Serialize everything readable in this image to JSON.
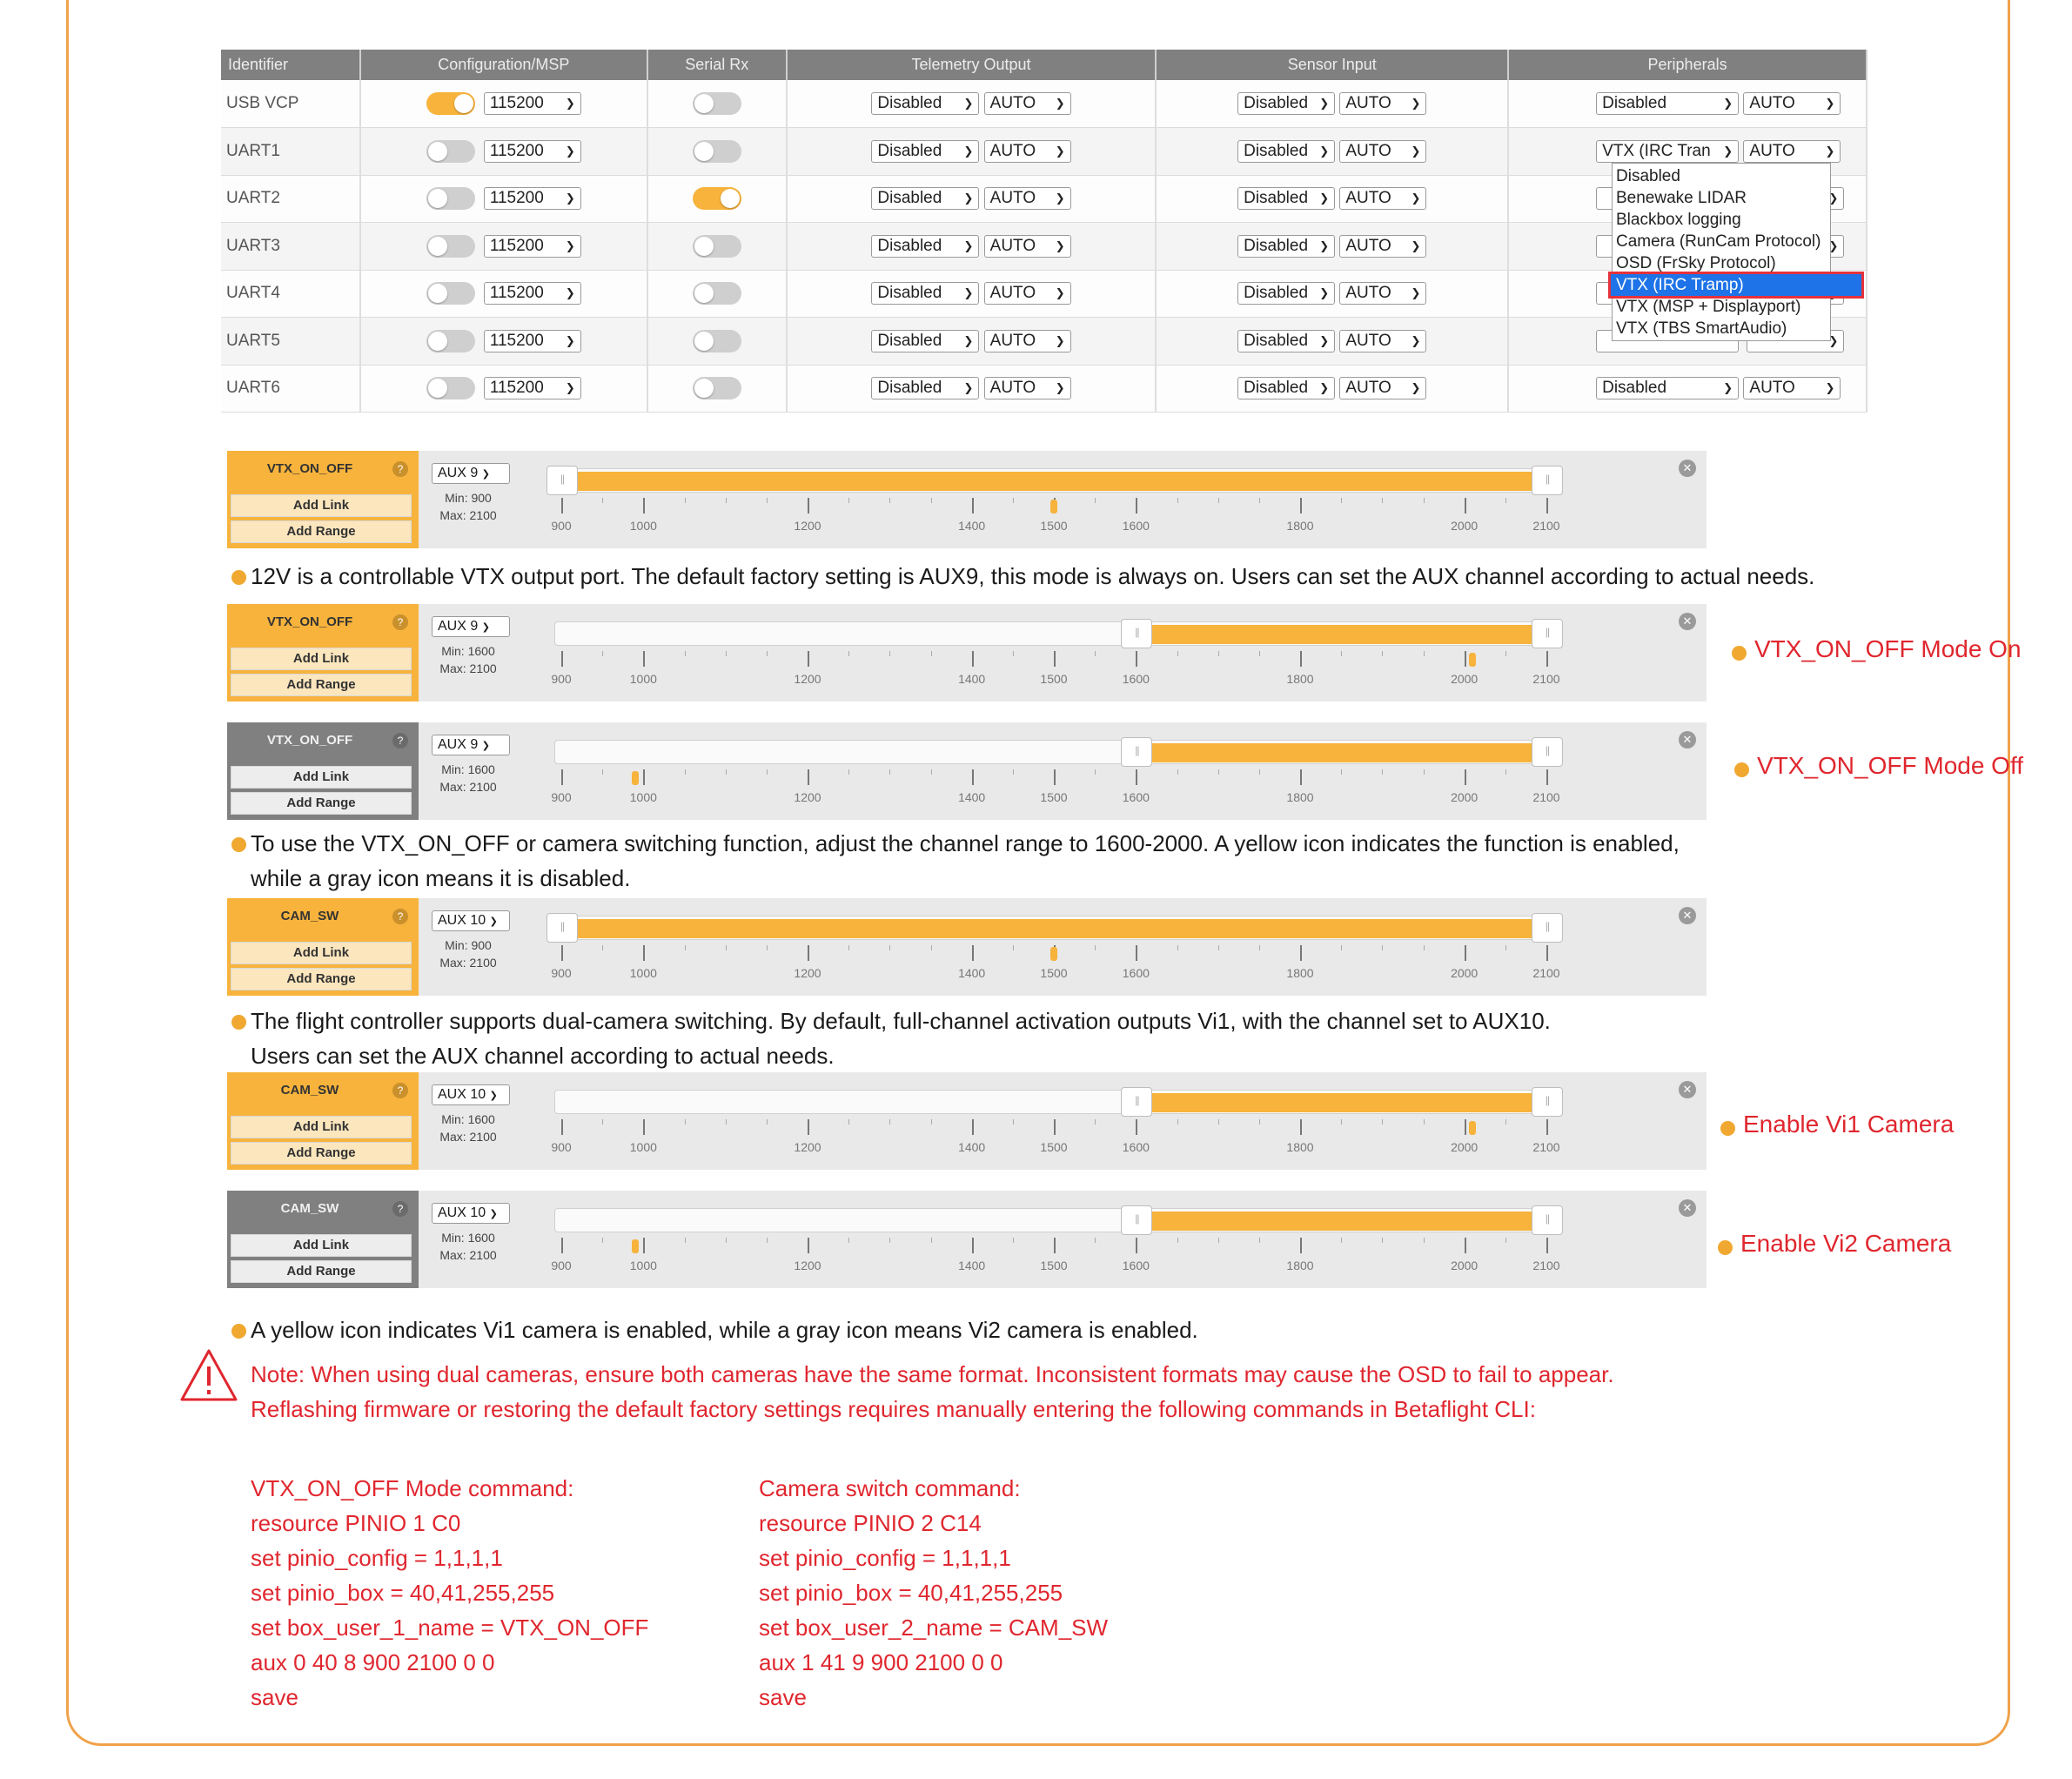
{
  "ports_table": {
    "headers": [
      "Identifier",
      "Configuration/MSP",
      "Serial Rx",
      "Telemetry Output",
      "Sensor Input",
      "Peripherals"
    ],
    "rows": [
      {
        "id": "USB VCP",
        "msp_on": true,
        "baud": "115200",
        "rx_on": false,
        "tel": "Disabled",
        "tel_auto": "AUTO",
        "sen": "Disabled",
        "sen_auto": "AUTO",
        "per": "Disabled",
        "per_auto": "AUTO"
      },
      {
        "id": "UART1",
        "msp_on": false,
        "baud": "115200",
        "rx_on": false,
        "tel": "Disabled",
        "tel_auto": "AUTO",
        "sen": "Disabled",
        "sen_auto": "AUTO",
        "per": "VTX (IRC Tran",
        "per_auto": "AUTO"
      },
      {
        "id": "UART2",
        "msp_on": false,
        "baud": "115200",
        "rx_on": true,
        "tel": "Disabled",
        "tel_auto": "AUTO",
        "sen": "Disabled",
        "sen_auto": "AUTO",
        "per": "",
        "per_auto": ""
      },
      {
        "id": "UART3",
        "msp_on": false,
        "baud": "115200",
        "rx_on": false,
        "tel": "Disabled",
        "tel_auto": "AUTO",
        "sen": "Disabled",
        "sen_auto": "AUTO",
        "per": "",
        "per_auto": ""
      },
      {
        "id": "UART4",
        "msp_on": false,
        "baud": "115200",
        "rx_on": false,
        "tel": "Disabled",
        "tel_auto": "AUTO",
        "sen": "Disabled",
        "sen_auto": "AUTO",
        "per": "",
        "per_auto": ""
      },
      {
        "id": "UART5",
        "msp_on": false,
        "baud": "115200",
        "rx_on": false,
        "tel": "Disabled",
        "tel_auto": "AUTO",
        "sen": "Disabled",
        "sen_auto": "AUTO",
        "per": "",
        "per_auto": ""
      },
      {
        "id": "UART6",
        "msp_on": false,
        "baud": "115200",
        "rx_on": false,
        "tel": "Disabled",
        "tel_auto": "AUTO",
        "sen": "Disabled",
        "sen_auto": "AUTO",
        "per": "Disabled",
        "per_auto": "AUTO"
      }
    ],
    "peripheral_dropdown": {
      "options": [
        "Disabled",
        "Benewake LIDAR",
        "Blackbox logging",
        "Camera (RunCam Protocol)",
        "OSD (FrSky Protocol)",
        "VTX (IRC Tramp)",
        "VTX (MSP + Displayport)",
        "VTX (TBS SmartAudio)"
      ],
      "selected": "VTX (IRC Tramp)"
    }
  },
  "mode_panels": [
    {
      "name": "VTX_ON_OFF",
      "active": true,
      "aux": "AUX 9",
      "min": "Min: 900",
      "max": "Max: 2100",
      "range": [
        900,
        2100
      ],
      "marker": 1500
    },
    {
      "name": "VTX_ON_OFF",
      "active": true,
      "aux": "AUX 9",
      "min": "Min: 1600",
      "max": "Max: 2100",
      "range": [
        1600,
        2100
      ],
      "marker": 2010,
      "label": "VTX_ON_OFF Mode On"
    },
    {
      "name": "VTX_ON_OFF",
      "active": false,
      "aux": "AUX 9",
      "min": "Min: 1600",
      "max": "Max: 2100",
      "range": [
        1600,
        2100
      ],
      "marker": 990,
      "label": "VTX_ON_OFF Mode Off"
    },
    {
      "name": "CAM_SW",
      "active": true,
      "aux": "AUX 10",
      "min": "Min: 900",
      "max": "Max: 2100",
      "range": [
        900,
        2100
      ],
      "marker": 1500
    },
    {
      "name": "CAM_SW",
      "active": true,
      "aux": "AUX 10",
      "min": "Min: 1600",
      "max": "Max: 2100",
      "range": [
        1600,
        2100
      ],
      "marker": 2010,
      "label": "Enable Vi1 Camera"
    },
    {
      "name": "CAM_SW",
      "active": false,
      "aux": "AUX 10",
      "min": "Min: 1600",
      "max": "Max: 2100",
      "range": [
        1600,
        2100
      ],
      "marker": 990,
      "label": "Enable Vi2 Camera"
    }
  ],
  "mode_buttons": {
    "add_link": "Add Link",
    "add_range": "Add Range"
  },
  "scale": {
    "min": 900,
    "max": 2100,
    "labels": [
      900,
      1000,
      1200,
      1400,
      1500,
      1600,
      1800,
      2000,
      2100
    ]
  },
  "text": {
    "p1": "12V is a controllable VTX output port. The default factory setting is AUX9, this mode is always on. Users can set the AUX channel according to actual needs.",
    "p2a": "To use the VTX_ON_OFF or camera switching function, adjust the channel range to 1600-2000. A yellow icon indicates the function is enabled,",
    "p2b": "while a gray icon means it is disabled.",
    "p3a": "The flight controller supports dual-camera switching. By default, full-channel activation outputs Vi1, with the channel set to AUX10.",
    "p3b": "Users can set the AUX channel according to actual needs.",
    "p4": "A yellow icon indicates Vi1 camera is enabled, while a gray icon means Vi2 camera is enabled.",
    "note1": "Note: When using dual cameras, ensure both cameras have the same format. Inconsistent formats may cause the OSD to fail to appear.",
    "note2": "Reflashing firmware or restoring the default factory settings requires manually entering the following commands in Betaflight CLI:"
  },
  "commands": {
    "vtx": [
      "VTX_ON_OFF Mode command:",
      "resource PINIO 1 C0",
      "set pinio_config = 1,1,1,1",
      "set pinio_box = 40,41,255,255",
      "set box_user_1_name = VTX_ON_OFF",
      "aux 0 40 8 900 2100 0 0",
      "save"
    ],
    "cam": [
      "Camera switch command:",
      "resource PINIO 2 C14",
      "set pinio_config = 1,1,1,1",
      "set pinio_box = 40,41,255,255",
      "set box_user_2_name = CAM_SW",
      "aux 1 41 9 900 2100 0 0",
      "save"
    ]
  },
  "colors": {
    "accent": "#f7b33c",
    "warning": "#e0262e",
    "frame": "#f0a24a",
    "header": "#808080"
  }
}
